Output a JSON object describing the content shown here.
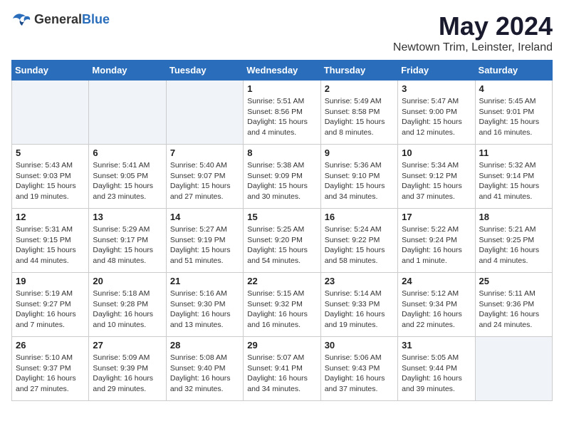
{
  "header": {
    "logo_general": "General",
    "logo_blue": "Blue",
    "month_title": "May 2024",
    "location": "Newtown Trim, Leinster, Ireland"
  },
  "weekdays": [
    "Sunday",
    "Monday",
    "Tuesday",
    "Wednesday",
    "Thursday",
    "Friday",
    "Saturday"
  ],
  "weeks": [
    [
      {
        "day": "",
        "empty": true
      },
      {
        "day": "",
        "empty": true
      },
      {
        "day": "",
        "empty": true
      },
      {
        "day": "1",
        "sunrise": "5:51 AM",
        "sunset": "8:56 PM",
        "daylight": "15 hours and 4 minutes."
      },
      {
        "day": "2",
        "sunrise": "5:49 AM",
        "sunset": "8:58 PM",
        "daylight": "15 hours and 8 minutes."
      },
      {
        "day": "3",
        "sunrise": "5:47 AM",
        "sunset": "9:00 PM",
        "daylight": "15 hours and 12 minutes."
      },
      {
        "day": "4",
        "sunrise": "5:45 AM",
        "sunset": "9:01 PM",
        "daylight": "15 hours and 16 minutes."
      }
    ],
    [
      {
        "day": "5",
        "sunrise": "5:43 AM",
        "sunset": "9:03 PM",
        "daylight": "15 hours and 19 minutes."
      },
      {
        "day": "6",
        "sunrise": "5:41 AM",
        "sunset": "9:05 PM",
        "daylight": "15 hours and 23 minutes."
      },
      {
        "day": "7",
        "sunrise": "5:40 AM",
        "sunset": "9:07 PM",
        "daylight": "15 hours and 27 minutes."
      },
      {
        "day": "8",
        "sunrise": "5:38 AM",
        "sunset": "9:09 PM",
        "daylight": "15 hours and 30 minutes."
      },
      {
        "day": "9",
        "sunrise": "5:36 AM",
        "sunset": "9:10 PM",
        "daylight": "15 hours and 34 minutes."
      },
      {
        "day": "10",
        "sunrise": "5:34 AM",
        "sunset": "9:12 PM",
        "daylight": "15 hours and 37 minutes."
      },
      {
        "day": "11",
        "sunrise": "5:32 AM",
        "sunset": "9:14 PM",
        "daylight": "15 hours and 41 minutes."
      }
    ],
    [
      {
        "day": "12",
        "sunrise": "5:31 AM",
        "sunset": "9:15 PM",
        "daylight": "15 hours and 44 minutes."
      },
      {
        "day": "13",
        "sunrise": "5:29 AM",
        "sunset": "9:17 PM",
        "daylight": "15 hours and 48 minutes."
      },
      {
        "day": "14",
        "sunrise": "5:27 AM",
        "sunset": "9:19 PM",
        "daylight": "15 hours and 51 minutes."
      },
      {
        "day": "15",
        "sunrise": "5:25 AM",
        "sunset": "9:20 PM",
        "daylight": "15 hours and 54 minutes."
      },
      {
        "day": "16",
        "sunrise": "5:24 AM",
        "sunset": "9:22 PM",
        "daylight": "15 hours and 58 minutes."
      },
      {
        "day": "17",
        "sunrise": "5:22 AM",
        "sunset": "9:24 PM",
        "daylight": "16 hours and 1 minute."
      },
      {
        "day": "18",
        "sunrise": "5:21 AM",
        "sunset": "9:25 PM",
        "daylight": "16 hours and 4 minutes."
      }
    ],
    [
      {
        "day": "19",
        "sunrise": "5:19 AM",
        "sunset": "9:27 PM",
        "daylight": "16 hours and 7 minutes."
      },
      {
        "day": "20",
        "sunrise": "5:18 AM",
        "sunset": "9:28 PM",
        "daylight": "16 hours and 10 minutes."
      },
      {
        "day": "21",
        "sunrise": "5:16 AM",
        "sunset": "9:30 PM",
        "daylight": "16 hours and 13 minutes."
      },
      {
        "day": "22",
        "sunrise": "5:15 AM",
        "sunset": "9:32 PM",
        "daylight": "16 hours and 16 minutes."
      },
      {
        "day": "23",
        "sunrise": "5:14 AM",
        "sunset": "9:33 PM",
        "daylight": "16 hours and 19 minutes."
      },
      {
        "day": "24",
        "sunrise": "5:12 AM",
        "sunset": "9:34 PM",
        "daylight": "16 hours and 22 minutes."
      },
      {
        "day": "25",
        "sunrise": "5:11 AM",
        "sunset": "9:36 PM",
        "daylight": "16 hours and 24 minutes."
      }
    ],
    [
      {
        "day": "26",
        "sunrise": "5:10 AM",
        "sunset": "9:37 PM",
        "daylight": "16 hours and 27 minutes."
      },
      {
        "day": "27",
        "sunrise": "5:09 AM",
        "sunset": "9:39 PM",
        "daylight": "16 hours and 29 minutes."
      },
      {
        "day": "28",
        "sunrise": "5:08 AM",
        "sunset": "9:40 PM",
        "daylight": "16 hours and 32 minutes."
      },
      {
        "day": "29",
        "sunrise": "5:07 AM",
        "sunset": "9:41 PM",
        "daylight": "16 hours and 34 minutes."
      },
      {
        "day": "30",
        "sunrise": "5:06 AM",
        "sunset": "9:43 PM",
        "daylight": "16 hours and 37 minutes."
      },
      {
        "day": "31",
        "sunrise": "5:05 AM",
        "sunset": "9:44 PM",
        "daylight": "16 hours and 39 minutes."
      },
      {
        "day": "",
        "empty": true
      }
    ]
  ],
  "labels": {
    "sunrise": "Sunrise:",
    "sunset": "Sunset:",
    "daylight": "Daylight hours"
  }
}
